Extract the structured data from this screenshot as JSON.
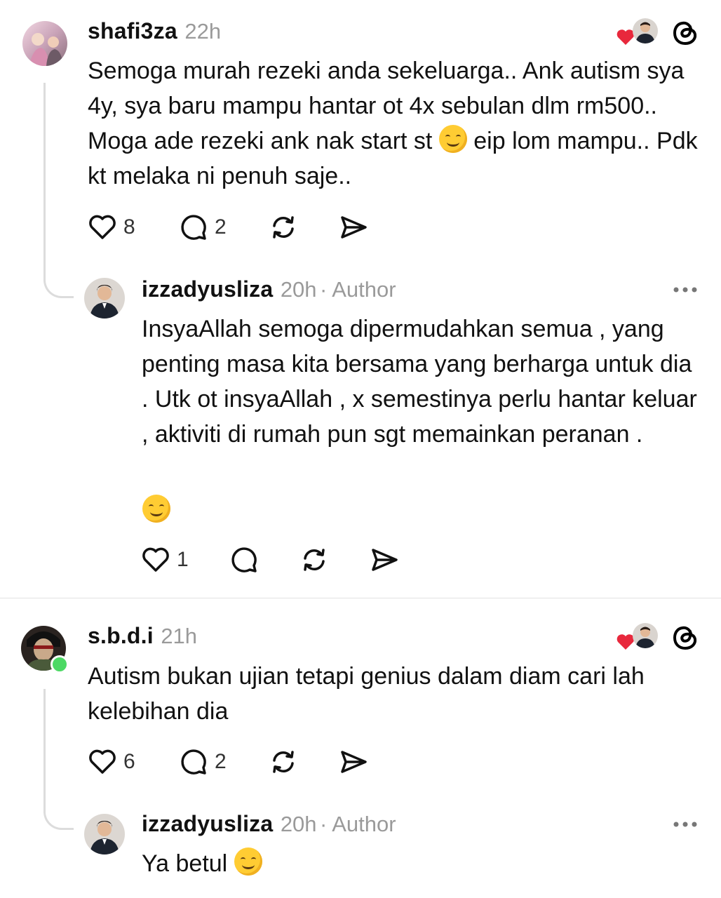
{
  "comments": [
    {
      "username": "shafi3za",
      "time": "22h",
      "text_before_emoji": "Semoga murah rezeki anda sekeluarga.. Ank autism sya 4y, sya baru mampu hantar ot 4x sebulan dlm rm500.. Moga ade rezeki ank nak start st ",
      "text_after_emoji": " eip lom mampu.. Pdk kt melaka ni penuh saje..",
      "likes": "8",
      "replies": "2"
    },
    {
      "username": "s.b.d.i",
      "time": "21h",
      "text": "Autism bukan ujian tetapi genius dalam diam cari lah kelebihan dia",
      "likes": "6",
      "replies": "2"
    }
  ],
  "replies": [
    {
      "username": "izzadyusliza",
      "time": "20h",
      "badge": "· Author",
      "text": "InsyaAllah semoga dipermudahkan semua , yang penting masa kita bersama yang berharga untuk dia . Utk ot insyaAllah , x semestinya perlu hantar keluar , aktiviti di rumah pun sgt memainkan peranan .",
      "likes": "1"
    },
    {
      "username": "izzadyusliza",
      "time": "20h",
      "badge": "· Author",
      "text": "Ya betul "
    }
  ],
  "colors": {
    "heart": "#e8283c",
    "online": "#4cd964",
    "muted_text": "#9a9a9a"
  },
  "icons": [
    "heart-icon",
    "comment-icon",
    "repost-icon",
    "share-icon",
    "threads-logo-icon",
    "more-icon"
  ]
}
